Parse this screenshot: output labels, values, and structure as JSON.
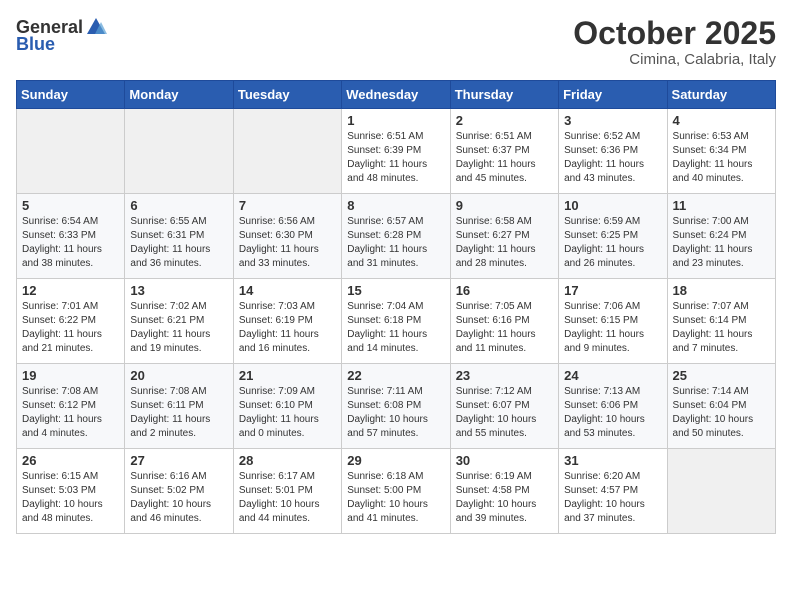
{
  "header": {
    "logo_general": "General",
    "logo_blue": "Blue",
    "month": "October 2025",
    "location": "Cimina, Calabria, Italy"
  },
  "weekdays": [
    "Sunday",
    "Monday",
    "Tuesday",
    "Wednesday",
    "Thursday",
    "Friday",
    "Saturday"
  ],
  "weeks": [
    [
      {
        "day": "",
        "info": ""
      },
      {
        "day": "",
        "info": ""
      },
      {
        "day": "",
        "info": ""
      },
      {
        "day": "1",
        "info": "Sunrise: 6:51 AM\nSunset: 6:39 PM\nDaylight: 11 hours\nand 48 minutes."
      },
      {
        "day": "2",
        "info": "Sunrise: 6:51 AM\nSunset: 6:37 PM\nDaylight: 11 hours\nand 45 minutes."
      },
      {
        "day": "3",
        "info": "Sunrise: 6:52 AM\nSunset: 6:36 PM\nDaylight: 11 hours\nand 43 minutes."
      },
      {
        "day": "4",
        "info": "Sunrise: 6:53 AM\nSunset: 6:34 PM\nDaylight: 11 hours\nand 40 minutes."
      }
    ],
    [
      {
        "day": "5",
        "info": "Sunrise: 6:54 AM\nSunset: 6:33 PM\nDaylight: 11 hours\nand 38 minutes."
      },
      {
        "day": "6",
        "info": "Sunrise: 6:55 AM\nSunset: 6:31 PM\nDaylight: 11 hours\nand 36 minutes."
      },
      {
        "day": "7",
        "info": "Sunrise: 6:56 AM\nSunset: 6:30 PM\nDaylight: 11 hours\nand 33 minutes."
      },
      {
        "day": "8",
        "info": "Sunrise: 6:57 AM\nSunset: 6:28 PM\nDaylight: 11 hours\nand 31 minutes."
      },
      {
        "day": "9",
        "info": "Sunrise: 6:58 AM\nSunset: 6:27 PM\nDaylight: 11 hours\nand 28 minutes."
      },
      {
        "day": "10",
        "info": "Sunrise: 6:59 AM\nSunset: 6:25 PM\nDaylight: 11 hours\nand 26 minutes."
      },
      {
        "day": "11",
        "info": "Sunrise: 7:00 AM\nSunset: 6:24 PM\nDaylight: 11 hours\nand 23 minutes."
      }
    ],
    [
      {
        "day": "12",
        "info": "Sunrise: 7:01 AM\nSunset: 6:22 PM\nDaylight: 11 hours\nand 21 minutes."
      },
      {
        "day": "13",
        "info": "Sunrise: 7:02 AM\nSunset: 6:21 PM\nDaylight: 11 hours\nand 19 minutes."
      },
      {
        "day": "14",
        "info": "Sunrise: 7:03 AM\nSunset: 6:19 PM\nDaylight: 11 hours\nand 16 minutes."
      },
      {
        "day": "15",
        "info": "Sunrise: 7:04 AM\nSunset: 6:18 PM\nDaylight: 11 hours\nand 14 minutes."
      },
      {
        "day": "16",
        "info": "Sunrise: 7:05 AM\nSunset: 6:16 PM\nDaylight: 11 hours\nand 11 minutes."
      },
      {
        "day": "17",
        "info": "Sunrise: 7:06 AM\nSunset: 6:15 PM\nDaylight: 11 hours\nand 9 minutes."
      },
      {
        "day": "18",
        "info": "Sunrise: 7:07 AM\nSunset: 6:14 PM\nDaylight: 11 hours\nand 7 minutes."
      }
    ],
    [
      {
        "day": "19",
        "info": "Sunrise: 7:08 AM\nSunset: 6:12 PM\nDaylight: 11 hours\nand 4 minutes."
      },
      {
        "day": "20",
        "info": "Sunrise: 7:08 AM\nSunset: 6:11 PM\nDaylight: 11 hours\nand 2 minutes."
      },
      {
        "day": "21",
        "info": "Sunrise: 7:09 AM\nSunset: 6:10 PM\nDaylight: 11 hours\nand 0 minutes."
      },
      {
        "day": "22",
        "info": "Sunrise: 7:11 AM\nSunset: 6:08 PM\nDaylight: 10 hours\nand 57 minutes."
      },
      {
        "day": "23",
        "info": "Sunrise: 7:12 AM\nSunset: 6:07 PM\nDaylight: 10 hours\nand 55 minutes."
      },
      {
        "day": "24",
        "info": "Sunrise: 7:13 AM\nSunset: 6:06 PM\nDaylight: 10 hours\nand 53 minutes."
      },
      {
        "day": "25",
        "info": "Sunrise: 7:14 AM\nSunset: 6:04 PM\nDaylight: 10 hours\nand 50 minutes."
      }
    ],
    [
      {
        "day": "26",
        "info": "Sunrise: 6:15 AM\nSunset: 5:03 PM\nDaylight: 10 hours\nand 48 minutes."
      },
      {
        "day": "27",
        "info": "Sunrise: 6:16 AM\nSunset: 5:02 PM\nDaylight: 10 hours\nand 46 minutes."
      },
      {
        "day": "28",
        "info": "Sunrise: 6:17 AM\nSunset: 5:01 PM\nDaylight: 10 hours\nand 44 minutes."
      },
      {
        "day": "29",
        "info": "Sunrise: 6:18 AM\nSunset: 5:00 PM\nDaylight: 10 hours\nand 41 minutes."
      },
      {
        "day": "30",
        "info": "Sunrise: 6:19 AM\nSunset: 4:58 PM\nDaylight: 10 hours\nand 39 minutes."
      },
      {
        "day": "31",
        "info": "Sunrise: 6:20 AM\nSunset: 4:57 PM\nDaylight: 10 hours\nand 37 minutes."
      },
      {
        "day": "",
        "info": ""
      }
    ]
  ]
}
